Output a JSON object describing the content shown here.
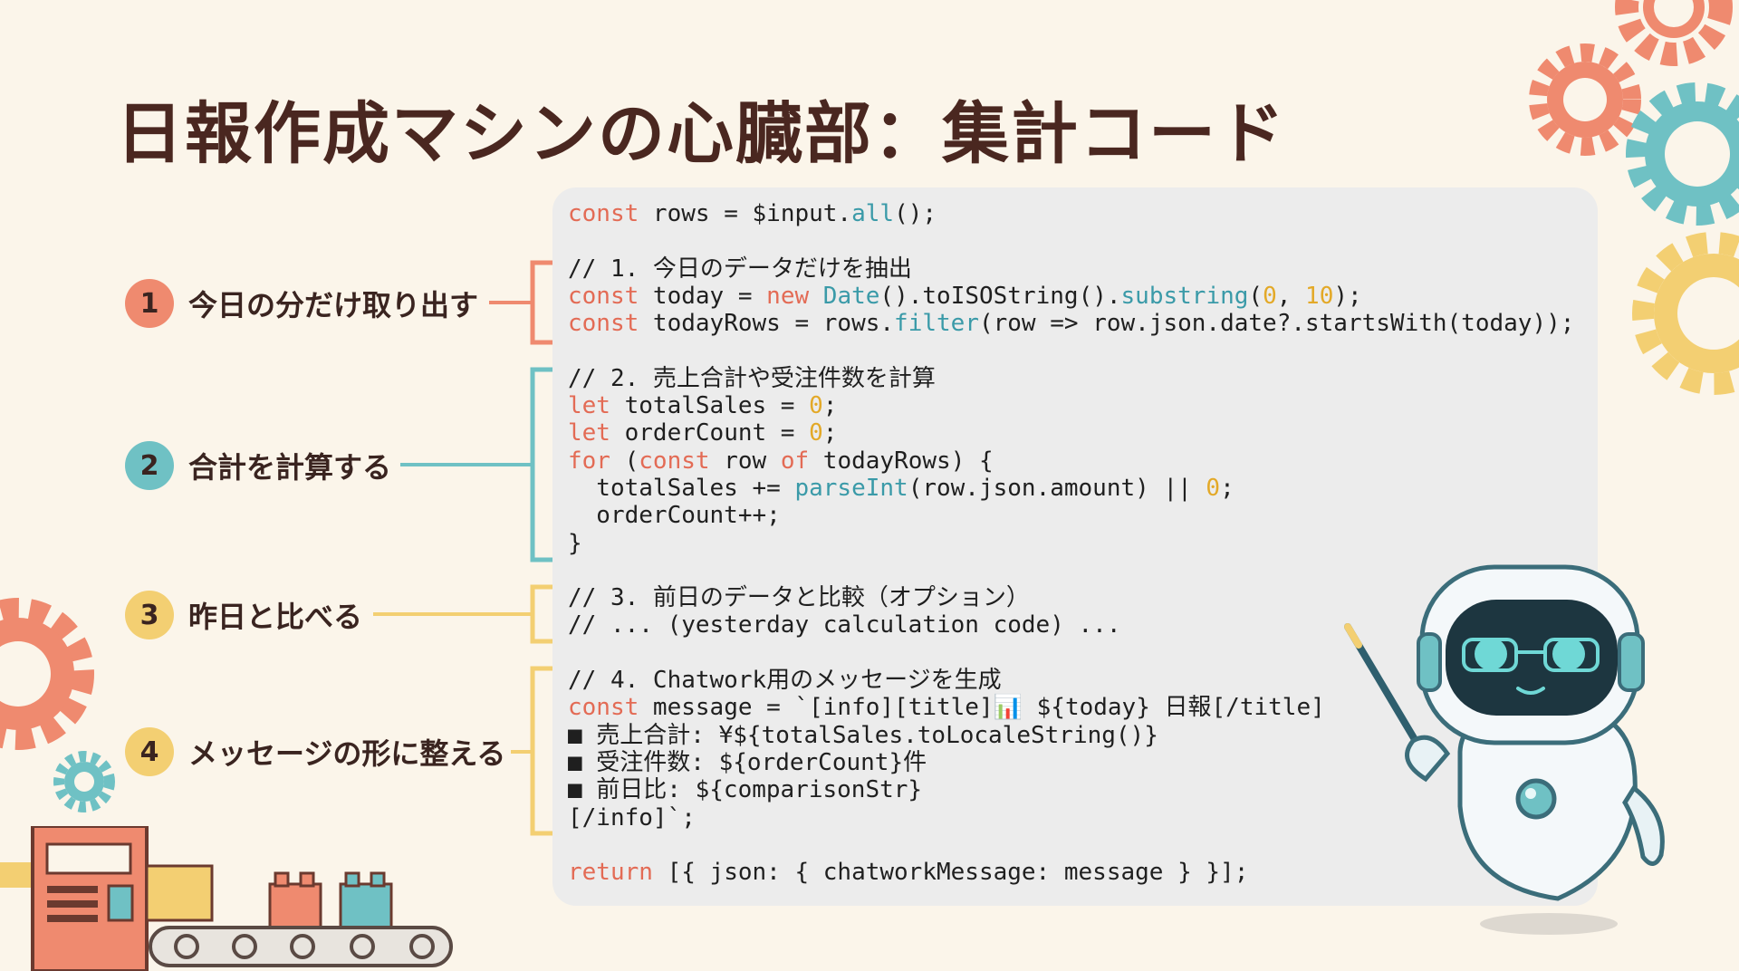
{
  "title": "日報作成マシンの心臓部：集計コード",
  "colors": {
    "background": "#fbf5ea",
    "panel": "#ececec",
    "step1": "#ef8a6f",
    "step2": "#6fc1c4",
    "step3": "#f3cf72",
    "step4": "#f3cf72",
    "keyword": "#e36b55",
    "function": "#3a9aa8",
    "number": "#e3a928"
  },
  "steps": [
    {
      "number": "1",
      "label": "今日の分だけ取り出す"
    },
    {
      "number": "2",
      "label": "合計を計算する"
    },
    {
      "number": "3",
      "label": "昨日と比べる"
    },
    {
      "number": "4",
      "label": "メッセージの形に整える"
    }
  ],
  "code": {
    "line1": [
      {
        "t": "const",
        "k": "kw"
      },
      {
        "t": " rows = $input."
      },
      {
        "t": "all",
        "k": "fn"
      },
      {
        "t": "();"
      }
    ],
    "line2": [
      {
        "t": "// 1. 今日のデータだけを抽出"
      }
    ],
    "line3": [
      {
        "t": "const",
        "k": "kw"
      },
      {
        "t": " today = "
      },
      {
        "t": "new",
        "k": "kw"
      },
      {
        "t": " "
      },
      {
        "t": "Date",
        "k": "fn"
      },
      {
        "t": "().toISOString()."
      },
      {
        "t": "substring",
        "k": "fn"
      },
      {
        "t": "("
      },
      {
        "t": "0",
        "k": "num"
      },
      {
        "t": ", "
      },
      {
        "t": "10",
        "k": "num"
      },
      {
        "t": ");"
      }
    ],
    "line4": [
      {
        "t": "const",
        "k": "kw"
      },
      {
        "t": " todayRows = rows."
      },
      {
        "t": "filter",
        "k": "fn"
      },
      {
        "t": "(row => row.json.date?.startsWith(today));"
      }
    ],
    "line5": [
      {
        "t": "// 2. 売上合計や受注件数を計算"
      }
    ],
    "line6": [
      {
        "t": "let",
        "k": "kw"
      },
      {
        "t": " totalSales = "
      },
      {
        "t": "0",
        "k": "num"
      },
      {
        "t": ";"
      }
    ],
    "line7": [
      {
        "t": "let",
        "k": "kw"
      },
      {
        "t": " orderCount = "
      },
      {
        "t": "0",
        "k": "num"
      },
      {
        "t": ";"
      }
    ],
    "line8": [
      {
        "t": "for",
        "k": "kw"
      },
      {
        "t": " ("
      },
      {
        "t": "const",
        "k": "kw"
      },
      {
        "t": " row "
      },
      {
        "t": "of",
        "k": "kw"
      },
      {
        "t": " todayRows) {"
      }
    ],
    "line9": [
      {
        "t": "  totalSales += "
      },
      {
        "t": "parseInt",
        "k": "fn"
      },
      {
        "t": "(row.json.amount) || "
      },
      {
        "t": "0",
        "k": "num"
      },
      {
        "t": ";"
      }
    ],
    "line10": [
      {
        "t": "  orderCount++;"
      }
    ],
    "line11": [
      {
        "t": "}"
      }
    ],
    "line12": [
      {
        "t": "// 3. 前日のデータと比較（オプション）"
      }
    ],
    "line13": [
      {
        "t": "// ... (yesterday calculation code) ..."
      }
    ],
    "line14": [
      {
        "t": "// 4. Chatwork用のメッセージを生成"
      }
    ],
    "line15": [
      {
        "t": "const",
        "k": "kw"
      },
      {
        "t": " message = `[info][title]📊 ${today} 日報[/title]"
      }
    ],
    "line16": [
      {
        "t": "■ 売上合計: ¥${totalSales.toLocaleString()}"
      }
    ],
    "line17": [
      {
        "t": "■ 受注件数: ${orderCount}件"
      }
    ],
    "line18": [
      {
        "t": "■ 前日比: ${comparisonStr}"
      }
    ],
    "line19": [
      {
        "t": "[/info]`;"
      }
    ],
    "line20": [
      {
        "t": "return",
        "k": "kw"
      },
      {
        "t": " [{ json: { chatworkMessage: message } }];"
      }
    ]
  },
  "icons": [
    "gear-icon",
    "robot-icon",
    "conveyor-icon",
    "pointer-icon"
  ]
}
